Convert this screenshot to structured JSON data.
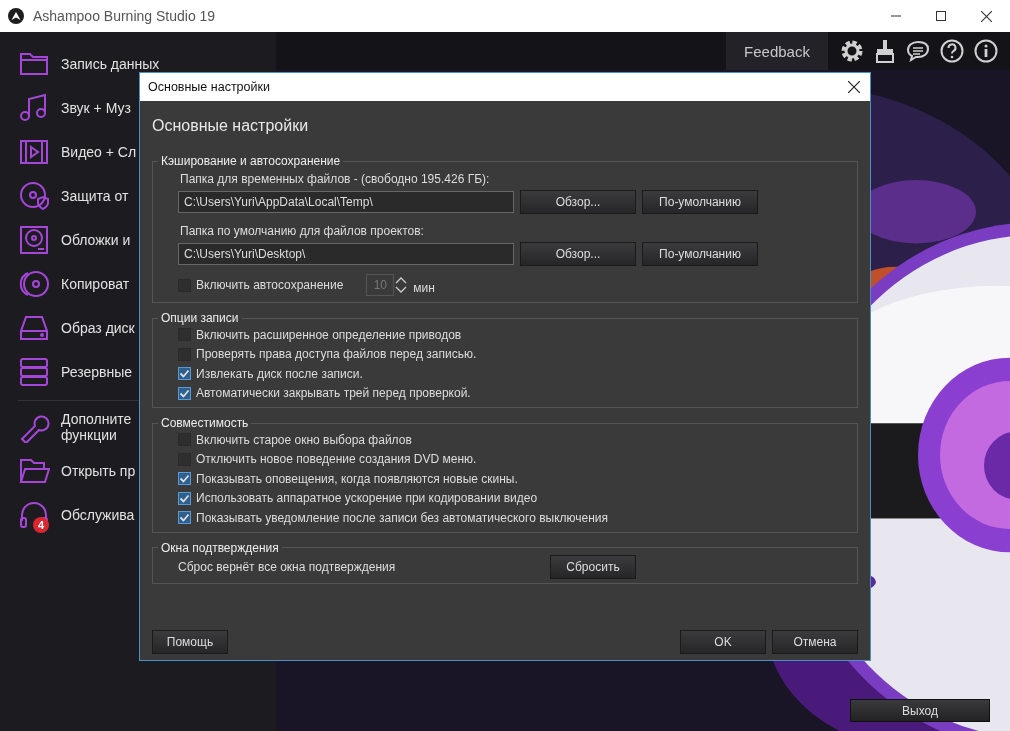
{
  "window": {
    "title": "Ashampoo Burning Studio 19"
  },
  "sidebar": {
    "sections": [
      [
        {
          "label": "Запись данных"
        },
        {
          "label": "Звук + Муз"
        },
        {
          "label": "Видео + Сл"
        },
        {
          "label": "Защита от"
        },
        {
          "label": "Обложки и"
        },
        {
          "label": "Копироват"
        },
        {
          "label": "Образ диск"
        },
        {
          "label": "Резервные"
        }
      ],
      [
        {
          "label": "Дополните\nфункции"
        },
        {
          "label": "Открыть пр"
        },
        {
          "label": "Обслужива",
          "badge": "4"
        }
      ]
    ]
  },
  "toolbar": {
    "feedback": "Feedback"
  },
  "exit_button": "Выход",
  "dialog": {
    "title": "Основные настройки",
    "heading": "Основные настройки",
    "caching": {
      "title": "Кэширование и автосохранение",
      "folders": [
        {
          "label": "Папка для временных файлов - (свободно 195.426  ГБ):",
          "value": "C:\\Users\\Yuri\\AppData\\Local\\Temp\\",
          "browse": "Обзор...",
          "default": "По-умолчанию"
        },
        {
          "label": "Папка по умолчанию для файлов проектов:",
          "value": "C:\\Users\\Yuri\\Desktop\\",
          "browse": "Обзор...",
          "default": "По-умолчанию"
        }
      ],
      "autosave": {
        "label": "Включить автосохранение",
        "checked": false,
        "value": "10",
        "unit": "мин"
      }
    },
    "groups": [
      {
        "title": "Опции записи",
        "options": [
          {
            "label": "Включить расширенное определение приводов",
            "checked": false
          },
          {
            "label": "Проверять права доступа файлов перед записью.",
            "checked": false
          },
          {
            "label": "Извлекать диск после записи.",
            "checked": true
          },
          {
            "label": "Автоматически закрывать трей перед проверкой.",
            "checked": true
          }
        ]
      },
      {
        "title": "Совместимость",
        "options": [
          {
            "label": "Включить старое окно выбора файлов",
            "checked": false
          },
          {
            "label": "Отключить новое поведение создания DVD меню.",
            "checked": false
          },
          {
            "label": "Показывать оповещения, когда появляются новые скины.",
            "checked": true
          },
          {
            "label": "Использовать аппаратное ускорение при кодировании видео",
            "checked": true
          },
          {
            "label": "Показывать уведомление после записи без автоматического выключения",
            "checked": true
          }
        ]
      }
    ],
    "confirm": {
      "title": "Окна подтверждения",
      "text": "Сброс вернёт все окна подтверждения",
      "button": "Сбросить"
    },
    "help": "Помощь",
    "ok": "OK",
    "cancel": "Отмена"
  }
}
